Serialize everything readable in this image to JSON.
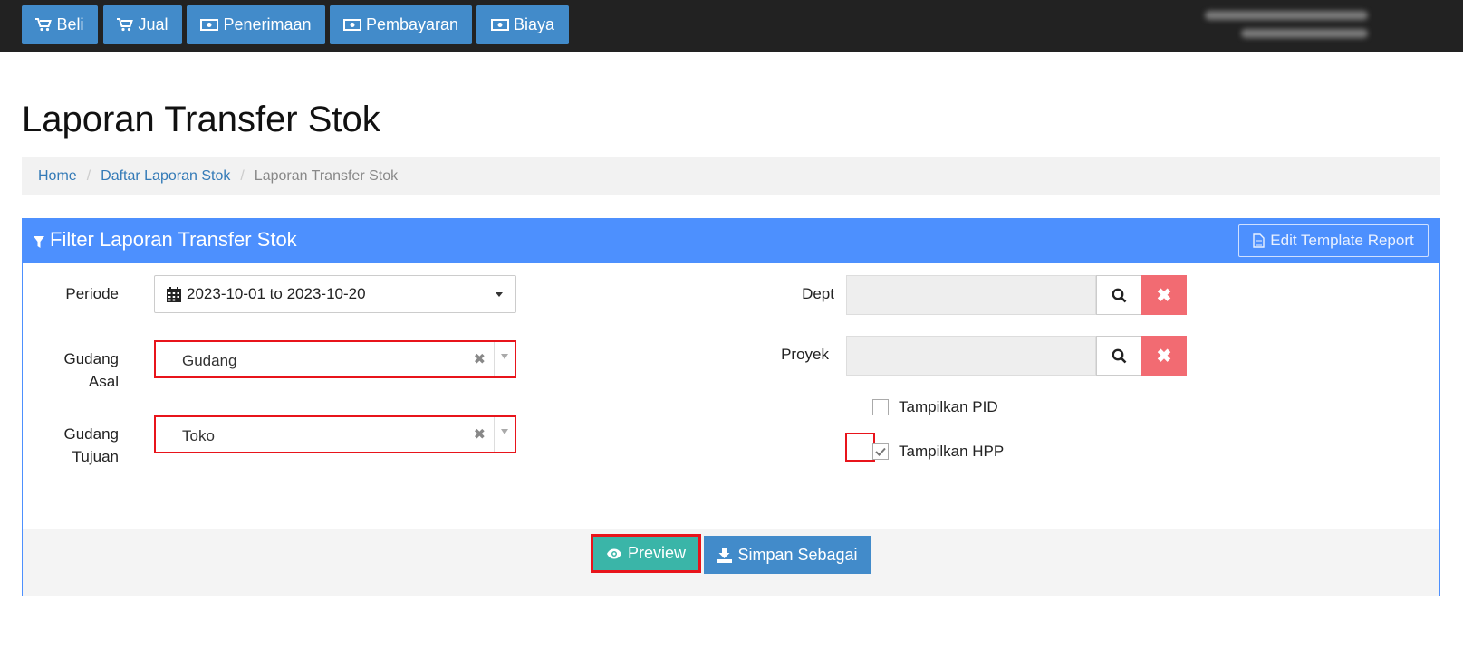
{
  "nav": {
    "items": [
      {
        "label": "Beli",
        "icon": "cart-icon"
      },
      {
        "label": "Jual",
        "icon": "cart-icon"
      },
      {
        "label": "Penerimaan",
        "icon": "money-icon"
      },
      {
        "label": "Pembayaran",
        "icon": "money-icon"
      },
      {
        "label": "Biaya",
        "icon": "money-icon"
      }
    ]
  },
  "page": {
    "title": "Laporan Transfer Stok"
  },
  "breadcrumb": {
    "home": "Home",
    "parent": "Daftar Laporan Stok",
    "current": "Laporan Transfer Stok"
  },
  "panel": {
    "title": "Filter Laporan Transfer Stok",
    "edit_template_label": "Edit Template Report"
  },
  "filters": {
    "periode_label": "Periode",
    "periode_value": "2023-10-01 to 2023-10-20",
    "gudang_asal_label_1": "Gudang",
    "gudang_asal_label_2": "Asal",
    "gudang_asal_value": "Gudang",
    "gudang_tujuan_label_1": "Gudang",
    "gudang_tujuan_label_2": "Tujuan",
    "gudang_tujuan_value": "Toko",
    "dept_label": "Dept",
    "proyek_label": "Proyek",
    "tampilkan_pid_label": "Tampilkan PID",
    "tampilkan_pid_checked": false,
    "tampilkan_hpp_label": "Tampilkan HPP",
    "tampilkan_hpp_checked": true
  },
  "actions": {
    "preview_label": "Preview",
    "save_as_label": "Simpan Sebagai"
  },
  "colors": {
    "topbar": "#222222",
    "primary": "#428bca",
    "panel_header": "#4d90fe",
    "preview": "#3ab5a8",
    "danger": "#f26b72",
    "highlight": "#e8141b"
  }
}
